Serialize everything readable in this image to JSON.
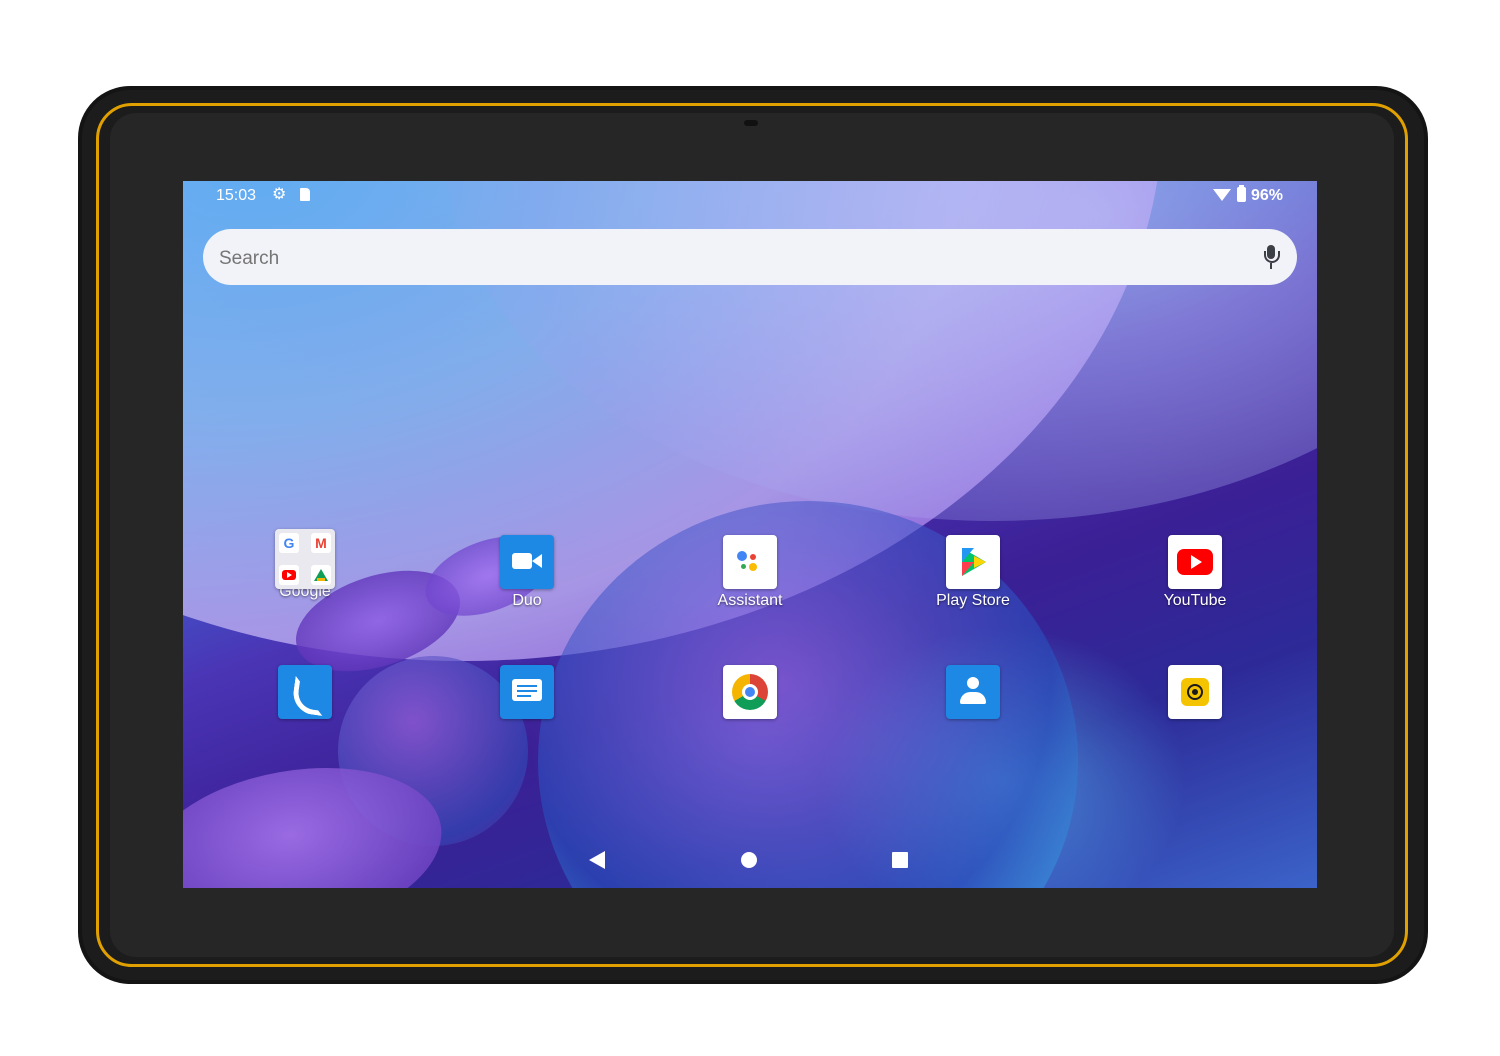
{
  "status_bar": {
    "time": "15:03",
    "battery_percent": "96%",
    "icons": [
      "gear-icon",
      "sd-card-icon",
      "wifi-icon",
      "battery-icon"
    ]
  },
  "search": {
    "placeholder": "Search",
    "mic_icon": "mic-icon"
  },
  "apps_row1": [
    {
      "label": "Google",
      "icon": "google-folder-icon"
    },
    {
      "label": "Duo",
      "icon": "duo-video-icon"
    },
    {
      "label": "Assistant",
      "icon": "assistant-icon"
    },
    {
      "label": "Play Store",
      "icon": "play-store-icon"
    },
    {
      "label": "YouTube",
      "icon": "youtube-icon"
    }
  ],
  "apps_row2": [
    {
      "icon": "phone-icon"
    },
    {
      "icon": "messages-icon"
    },
    {
      "icon": "chrome-icon"
    },
    {
      "icon": "contacts-icon"
    },
    {
      "icon": "camera-icon"
    }
  ],
  "folder_glyphs": {
    "g": "G",
    "m": "M"
  },
  "nav": {
    "back": "back-icon",
    "home": "home-icon",
    "recents": "recents-icon"
  },
  "colors": {
    "trim": "#e0a100",
    "bezel": "#1c1c1c",
    "accent_blue": "#1e88e5",
    "youtube_red": "#ff0000",
    "camera_yellow": "#f5c400"
  }
}
